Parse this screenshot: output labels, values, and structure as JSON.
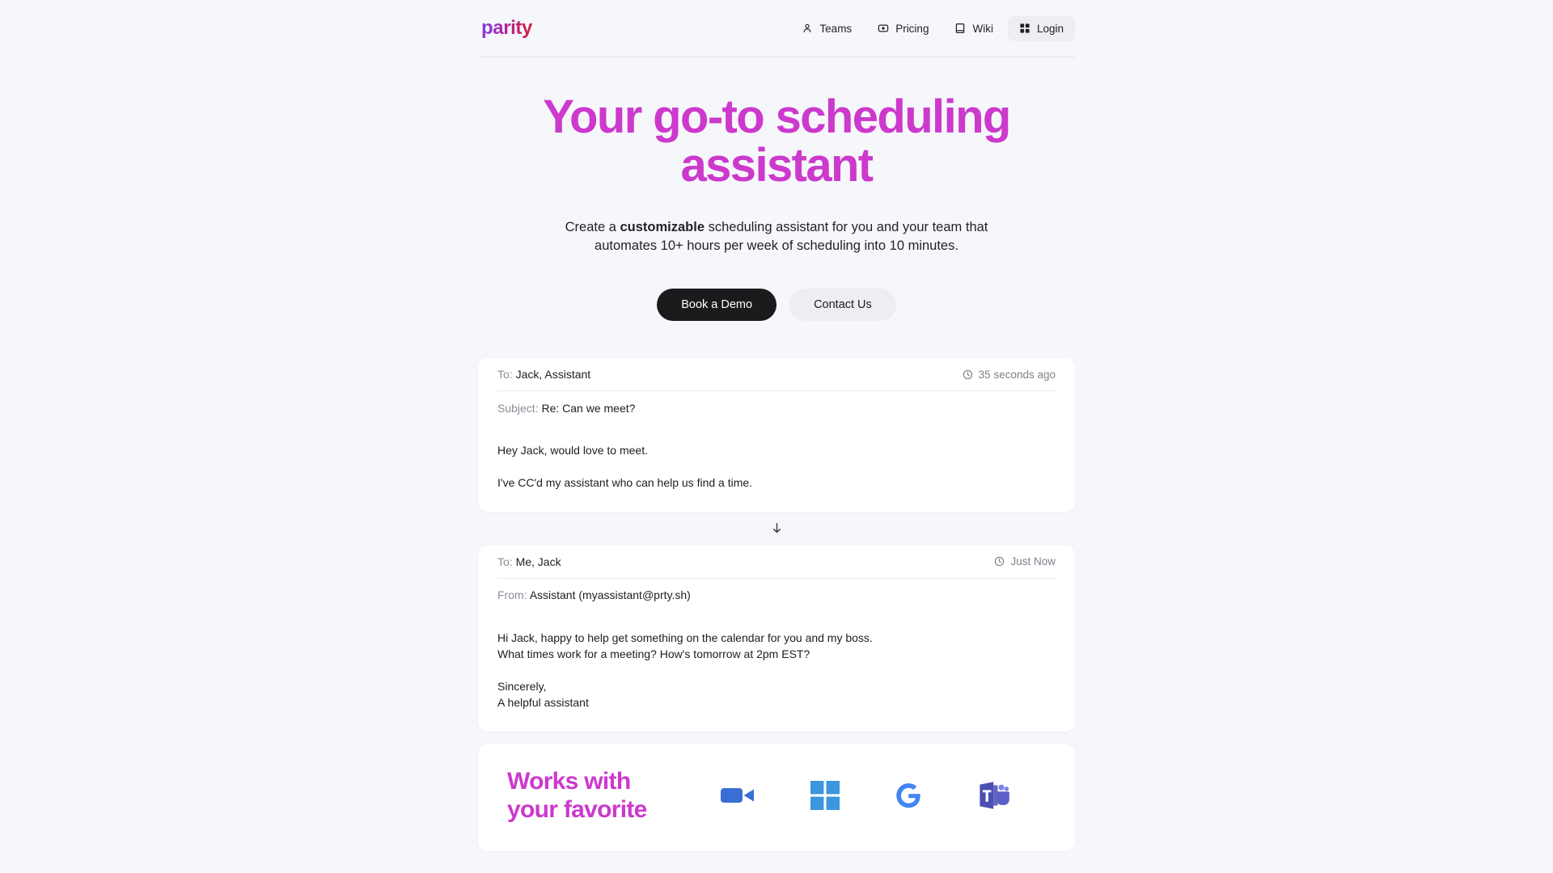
{
  "brand": {
    "logo_text": "parity",
    "gradient_from": "#7b3fe4",
    "gradient_to": "#cf1f45"
  },
  "header": {
    "nav": [
      {
        "label": "Teams",
        "icon": "people-icon",
        "active": false
      },
      {
        "label": "Pricing",
        "icon": "tag-icon",
        "active": false
      },
      {
        "label": "Wiki",
        "icon": "book-icon",
        "active": false
      },
      {
        "label": "Login",
        "icon": "grid-icon",
        "active": true
      }
    ]
  },
  "hero": {
    "title": "Your go-to scheduling assistant",
    "title_color": "#cc39cc",
    "subtitle_before": "Create a ",
    "subtitle_bold": "customizable",
    "subtitle_after": " scheduling assistant for you and your team that automates 10+ hours per week of scheduling into 10 minutes.",
    "primary_button": "Book a Demo",
    "secondary_button": "Contact Us",
    "primary_color": "#1b1b1d",
    "secondary_color": "#eceef2"
  },
  "emails": [
    {
      "to_label": "To:",
      "to_value": "Jack, Assistant",
      "time": "35 seconds ago",
      "subject_label": "Subject:",
      "subject_value": "Re: Can we meet?",
      "body_lines": [
        "Hey Jack, would love to meet.",
        "I've CC'd my assistant who can help us find a time."
      ]
    },
    {
      "to_label": "To:",
      "to_value": "Me, Jack",
      "time": "Just Now",
      "from_label": "From:",
      "from_value": "Assistant (myassistant@prty.sh)",
      "body_lines": [
        "Hi Jack, happy to help get something on the calendar for you and my boss.\nWhat times work for a meeting? How's tomorrow at 2pm EST?",
        "Sincerely,\nA helpful assistant"
      ]
    }
  ],
  "works_with": {
    "title": "Works with your favorite",
    "title_color": "#cc39cc",
    "logos": [
      {
        "name": "zoom-logo",
        "color": "#3b6ed4"
      },
      {
        "name": "microsoft-logo",
        "color": "#3a96dd"
      },
      {
        "name": "google-logo",
        "color": "#4285f4"
      },
      {
        "name": "microsoft-teams-logo",
        "color": "#5b5fc7"
      }
    ]
  }
}
